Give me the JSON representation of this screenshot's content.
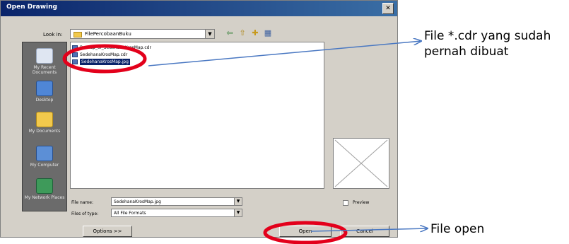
{
  "dialog": {
    "title": "Open Drawing",
    "close_label": "✕",
    "look_in_label": "Look in:",
    "look_in_value": "FilePercobaanBuku",
    "toolbar": {
      "back": "⇦",
      "up": "⇧",
      "new_folder": "✚",
      "views": "▦"
    }
  },
  "places": [
    {
      "label": "My Recent Documents",
      "icon": "recent-documents-icon"
    },
    {
      "label": "Desktop",
      "icon": "desktop-icon"
    },
    {
      "label": "My Documents",
      "icon": "my-documents-icon"
    },
    {
      "label": "My Computer",
      "icon": "my-computer-icon"
    },
    {
      "label": "My Network Places",
      "icon": "network-places-icon"
    }
  ],
  "files": [
    {
      "name": "Backup_of_SedehanaKrosMap.cdr",
      "selected": false
    },
    {
      "name": "SedehanaKrosMap.cdr",
      "selected": false
    },
    {
      "name": "SedehanaKrosMap.jpg",
      "selected": true
    }
  ],
  "file_name_label": "File name:",
  "file_name_value": "SedehanaKrosMap.jpg",
  "files_of_type_label": "Files of type:",
  "files_of_type_value": "All File Formats",
  "preview_label": "Preview",
  "options_button": "Options >>",
  "open_button": "Open",
  "cancel_button": "Cancel",
  "annotations": {
    "file_callout_line1": "File *.cdr yang sudah",
    "file_callout_line2": "pernah dibuat",
    "open_callout": "File open"
  },
  "colors": {
    "highlight": "#e3001b",
    "arrow": "#4a78c2",
    "selection": "#0a246a"
  }
}
